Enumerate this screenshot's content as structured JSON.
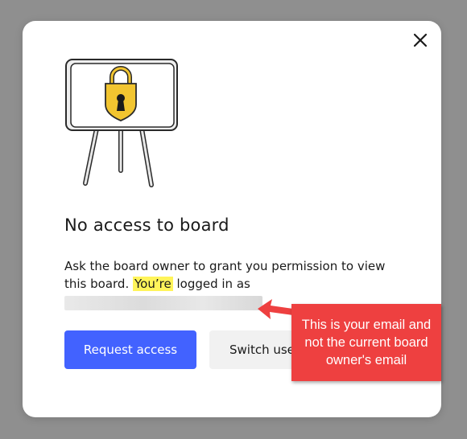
{
  "dialog": {
    "title": "No access to board",
    "description_before": "Ask the board owner to grant you permission to view this board. ",
    "description_highlight": "You’re",
    "description_after": " logged in as",
    "primary_button": "Request access",
    "secondary_button": "Switch user"
  },
  "annotation": {
    "text": "This is your email and not the current board owner's email"
  },
  "colors": {
    "primary": "#4262ff",
    "highlight": "#fff45a",
    "callout": "#ee4040",
    "lock": "#f2c530"
  },
  "icons": [
    "close-icon",
    "locked-board-illustration",
    "padlock-icon",
    "callout-arrow-icon"
  ]
}
